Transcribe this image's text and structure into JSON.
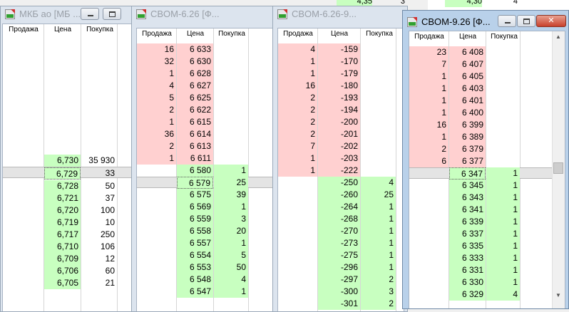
{
  "bg_top": {
    "a": {
      "sell": "4,35",
      "buy": "3"
    },
    "b": {
      "sell": "4,30",
      "buy": "4"
    }
  },
  "windows": [
    {
      "id": "w1",
      "title": "МКБ ао [МБ ...",
      "headers": {
        "sell": "Продажа",
        "price": "Цена",
        "buy": "Покупка"
      },
      "rows": [
        {
          "price": "6,730",
          "buy": "35 930"
        },
        {
          "price": "6,729",
          "buy": "33"
        },
        {
          "price": "6,728",
          "buy": "50"
        },
        {
          "price": "6,721",
          "buy": "37"
        },
        {
          "price": "6,720",
          "buy": "100"
        },
        {
          "price": "6,719",
          "buy": "10"
        },
        {
          "price": "6,717",
          "buy": "250"
        },
        {
          "price": "6,710",
          "buy": "106"
        },
        {
          "price": "6,709",
          "buy": "12"
        },
        {
          "price": "6,706",
          "buy": "60"
        },
        {
          "price": "6,705",
          "buy": "21"
        }
      ]
    },
    {
      "id": "w2",
      "title": "CBOM-6.26 [Ф...",
      "headers": {
        "sell": "Продажа",
        "price": "Цена",
        "buy": "Покупка"
      },
      "sells": [
        {
          "qty": "16",
          "price": "6 633"
        },
        {
          "qty": "32",
          "price": "6 630"
        },
        {
          "qty": "1",
          "price": "6 628"
        },
        {
          "qty": "4",
          "price": "6 627"
        },
        {
          "qty": "5",
          "price": "6 625"
        },
        {
          "qty": "2",
          "price": "6 622"
        },
        {
          "qty": "1",
          "price": "6 615"
        },
        {
          "qty": "36",
          "price": "6 614"
        },
        {
          "qty": "2",
          "price": "6 613"
        },
        {
          "qty": "1",
          "price": "6 611"
        }
      ],
      "buys": [
        {
          "price": "6 580",
          "qty": "1"
        },
        {
          "price": "6 579",
          "qty": "25"
        },
        {
          "price": "6 575",
          "qty": "39"
        },
        {
          "price": "6 569",
          "qty": "1"
        },
        {
          "price": "6 559",
          "qty": "3"
        },
        {
          "price": "6 558",
          "qty": "20"
        },
        {
          "price": "6 557",
          "qty": "1"
        },
        {
          "price": "6 554",
          "qty": "5"
        },
        {
          "price": "6 553",
          "qty": "50"
        },
        {
          "price": "6 548",
          "qty": "4"
        },
        {
          "price": "6 547",
          "qty": "1"
        }
      ]
    },
    {
      "id": "w3",
      "title": "CBOM-6.26-9...",
      "headers": {
        "sell": "Продажа",
        "price": "Цена",
        "buy": "Покупка"
      },
      "sells": [
        {
          "qty": "4",
          "price": "-159"
        },
        {
          "qty": "1",
          "price": "-170"
        },
        {
          "qty": "1",
          "price": "-179"
        },
        {
          "qty": "16",
          "price": "-180"
        },
        {
          "qty": "2",
          "price": "-193"
        },
        {
          "qty": "2",
          "price": "-194"
        },
        {
          "qty": "2",
          "price": "-200"
        },
        {
          "qty": "2",
          "price": "-201"
        },
        {
          "qty": "7",
          "price": "-202"
        },
        {
          "qty": "1",
          "price": "-203"
        },
        {
          "qty": "1",
          "price": "-222"
        }
      ],
      "buys": [
        {
          "price": "-250",
          "qty": "4"
        },
        {
          "price": "-260",
          "qty": "25"
        },
        {
          "price": "-264",
          "qty": "1"
        },
        {
          "price": "-268",
          "qty": "1"
        },
        {
          "price": "-270",
          "qty": "1"
        },
        {
          "price": "-273",
          "qty": "1"
        },
        {
          "price": "-275",
          "qty": "1"
        },
        {
          "price": "-296",
          "qty": "1"
        },
        {
          "price": "-297",
          "qty": "2"
        },
        {
          "price": "-300",
          "qty": "3"
        },
        {
          "price": "-301",
          "qty": "2"
        }
      ]
    },
    {
      "id": "w4",
      "title": "CBOM-9.26 [Ф...",
      "headers": {
        "sell": "Продажа",
        "price": "Цена",
        "buy": "Покупка"
      },
      "sells": [
        {
          "qty": "23",
          "price": "6 408"
        },
        {
          "qty": "7",
          "price": "6 407"
        },
        {
          "qty": "1",
          "price": "6 405"
        },
        {
          "qty": "1",
          "price": "6 403"
        },
        {
          "qty": "1",
          "price": "6 401"
        },
        {
          "qty": "1",
          "price": "6 400"
        },
        {
          "qty": "16",
          "price": "6 399"
        },
        {
          "qty": "1",
          "price": "6 389"
        },
        {
          "qty": "2",
          "price": "6 379"
        },
        {
          "qty": "6",
          "price": "6 377"
        }
      ],
      "buys": [
        {
          "price": "6 347",
          "qty": "1"
        },
        {
          "price": "6 345",
          "qty": "1"
        },
        {
          "price": "6 343",
          "qty": "1"
        },
        {
          "price": "6 341",
          "qty": "1"
        },
        {
          "price": "6 339",
          "qty": "1"
        },
        {
          "price": "6 337",
          "qty": "1"
        },
        {
          "price": "6 335",
          "qty": "1"
        },
        {
          "price": "6 333",
          "qty": "1"
        },
        {
          "price": "6 331",
          "qty": "1"
        },
        {
          "price": "6 330",
          "qty": "1"
        },
        {
          "price": "6 329",
          "qty": "4"
        }
      ]
    }
  ],
  "colors": {
    "sell_bg": "#ffd0d0",
    "buy_bg": "#c8ffc0",
    "separator": "#e4e4e4",
    "active_frame": "#b9d1ea",
    "inactive_frame": "#dce4ee"
  },
  "icons": [
    "app-icon",
    "minimize-icon",
    "maximize-icon",
    "close-icon",
    "scroll-up-icon",
    "scroll-down-icon"
  ]
}
